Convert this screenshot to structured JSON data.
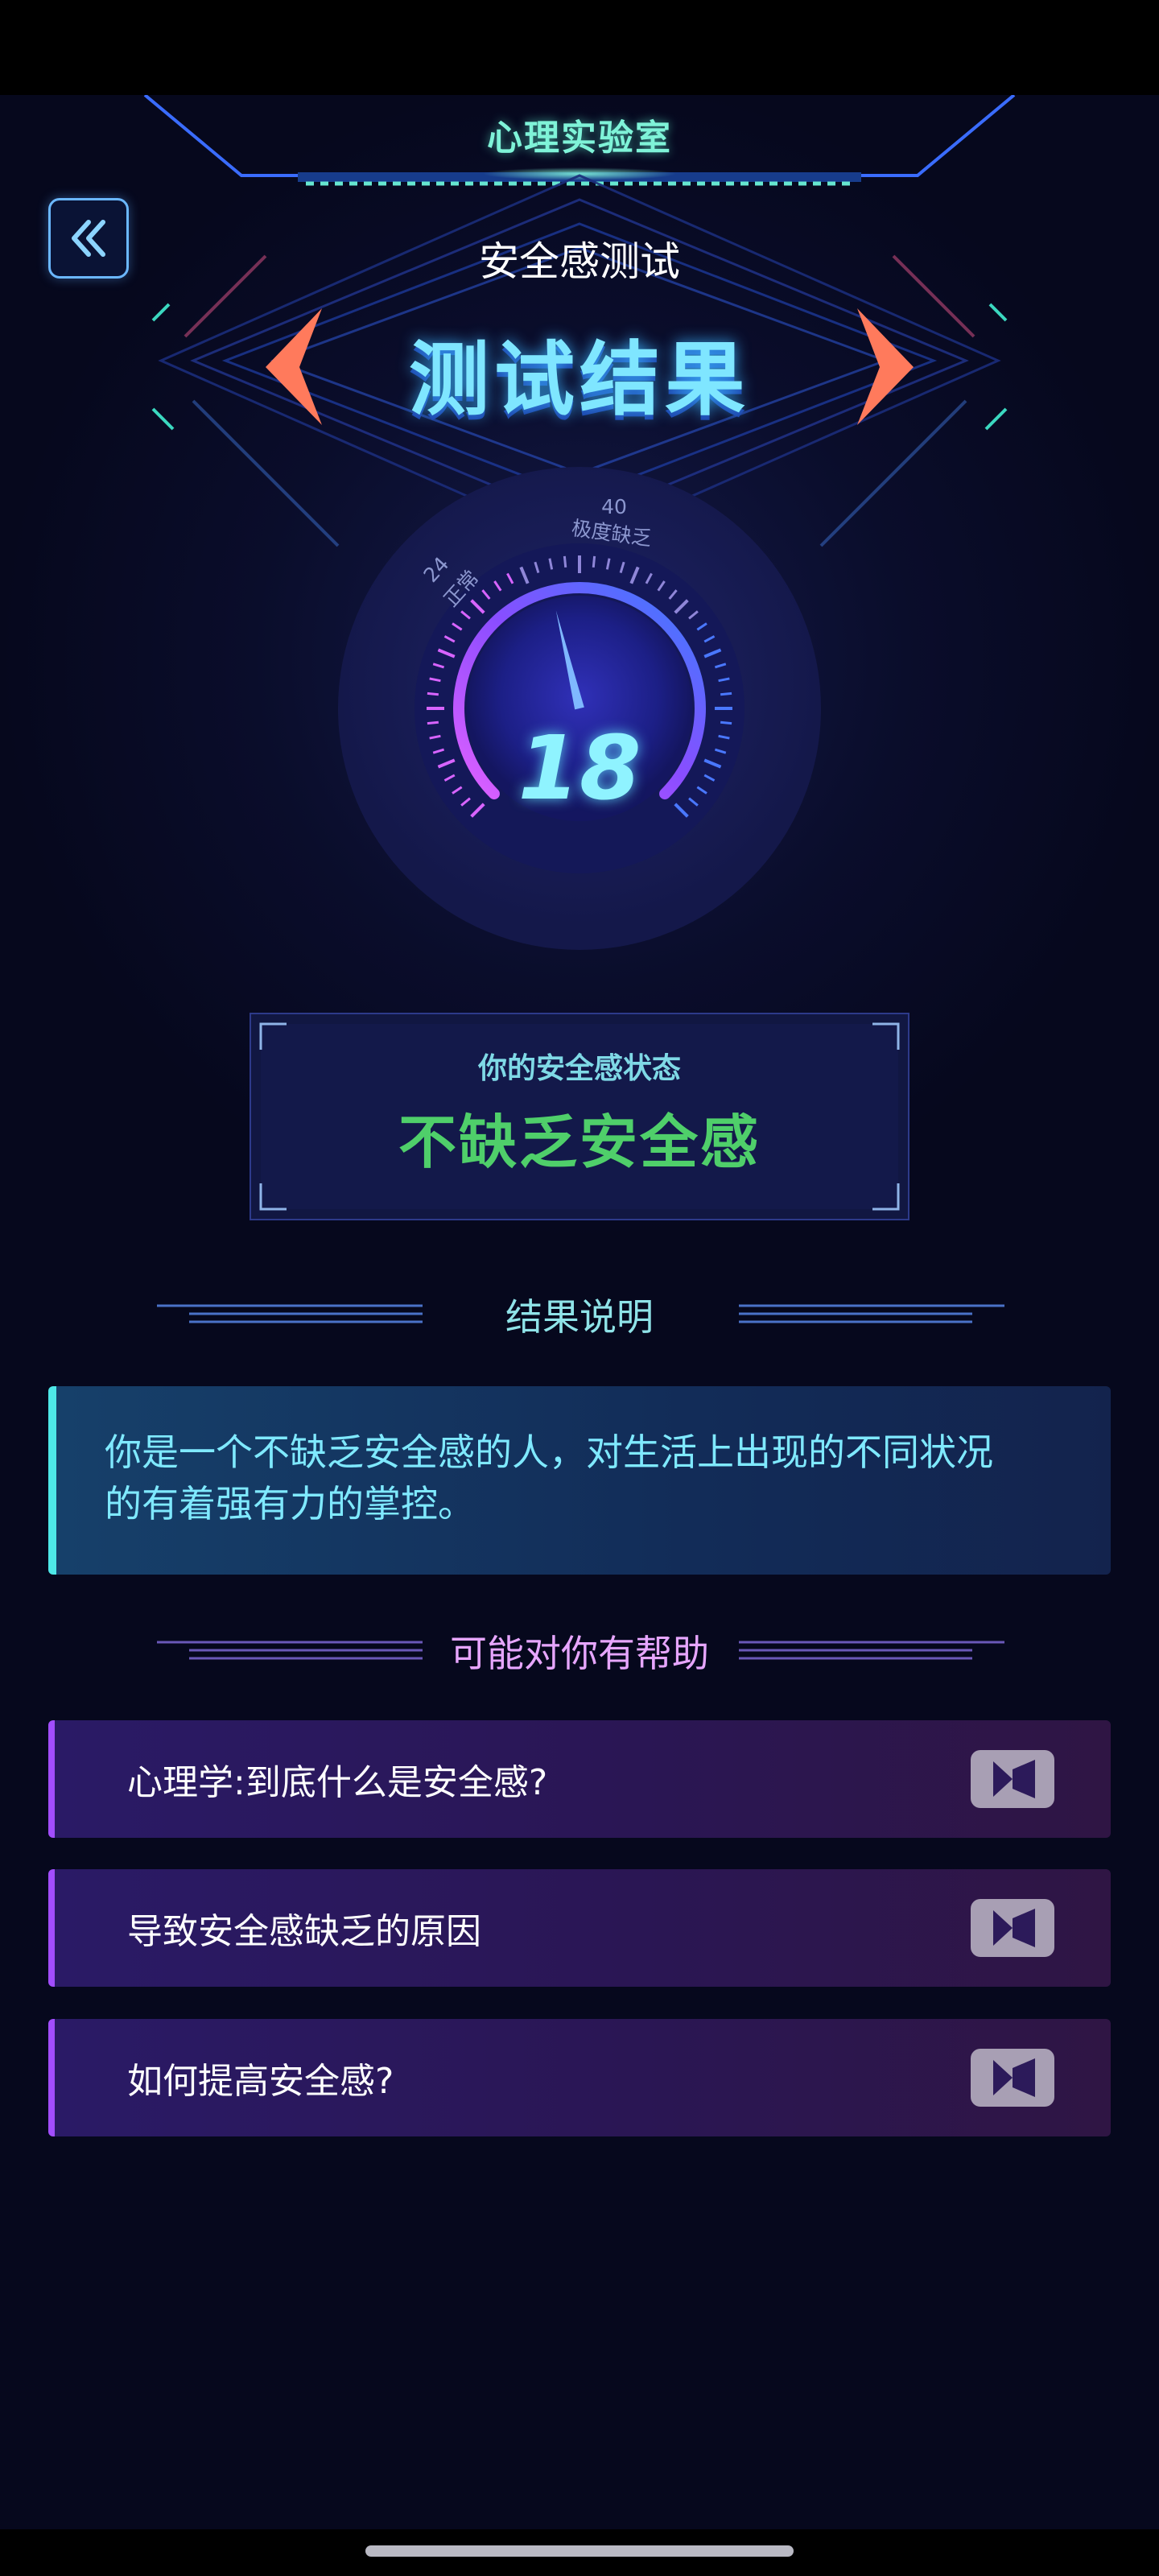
{
  "header": {
    "lab_title": "心理实验室",
    "test_name": "安全感测试",
    "result_heading": "测试结果"
  },
  "gauge": {
    "value": "18",
    "score": 18,
    "max_label": "40",
    "max_caption": "极度缺乏",
    "mid_label": "24",
    "mid_caption": "正常"
  },
  "status": {
    "caption": "你的安全感状态",
    "value": "不缺乏安全感"
  },
  "explanation": {
    "title": "结果说明",
    "lines": [
      "你是一个不缺乏安全感的人，对生活上出现的不同状况",
      "的有着强有力的掌控。"
    ]
  },
  "help": {
    "title": "可能对你有帮助",
    "items": [
      {
        "label": "心理学:到底什么是安全感?",
        "icon": "video-camera-icon"
      },
      {
        "label": "导致安全感缺乏的原因",
        "icon": "video-camera-icon"
      },
      {
        "label": "如何提高安全感?",
        "icon": "video-camera-icon"
      }
    ]
  },
  "colors": {
    "background": "#06081d",
    "accent_cyan": "#7fe9ff",
    "status_green": "#4fcf6a",
    "help_accent": "#a24dff"
  }
}
